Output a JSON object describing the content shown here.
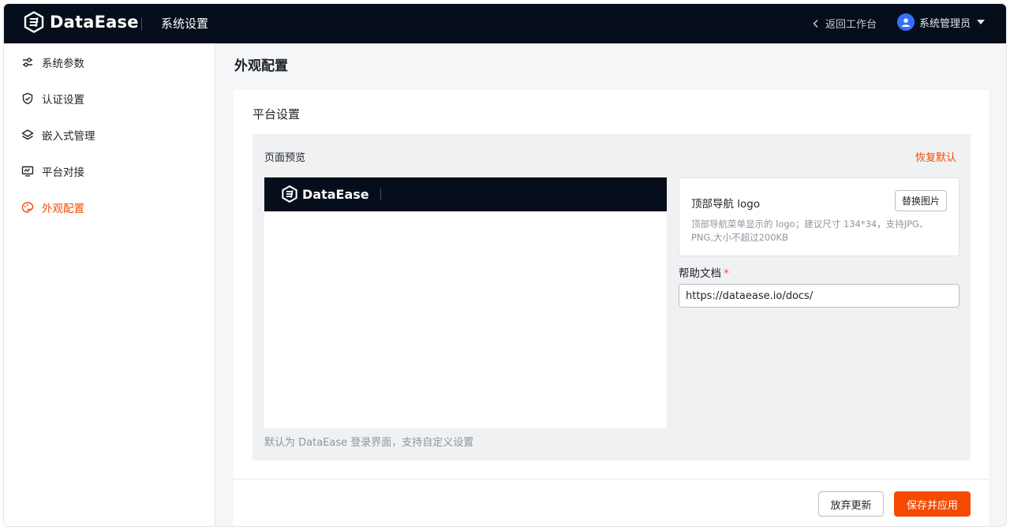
{
  "header": {
    "brand_name": "DataEase",
    "section_title": "系统设置",
    "back_label": "返回工作台",
    "user_name": "系统管理员",
    "bg_color": "#050e1a"
  },
  "sidebar": {
    "items": [
      {
        "label": "系统参数",
        "icon": "sliders-icon"
      },
      {
        "label": "认证设置",
        "icon": "shield-check-icon"
      },
      {
        "label": "嵌入式管理",
        "icon": "layers-icon"
      },
      {
        "label": "平台对接",
        "icon": "monitor-icon"
      },
      {
        "label": "外观配置",
        "icon": "palette-icon",
        "active": true
      }
    ]
  },
  "main": {
    "page_title": "外观配置",
    "card_title": "平台设置",
    "preview": {
      "label": "页面预览",
      "restore_label": "恢复默认",
      "brand_name": "DataEase",
      "note": "默认为 DataEase 登录界面，支持自定义设置"
    },
    "logo_setting": {
      "title": "顶部导航 logo",
      "button_label": "替换图片",
      "description": "顶部导航菜单显示的 logo；建议尺寸 134*34，支持JPG、PNG,大小不超过200KB"
    },
    "help_doc": {
      "label": "帮助文档",
      "required_mark": "*",
      "value": "https://dataease.io/docs/"
    },
    "footer": {
      "discard_label": "放弃更新",
      "save_label": "保存并应用"
    }
  },
  "colors": {
    "accent": "#f54a00",
    "avatar": "#3370ff"
  }
}
